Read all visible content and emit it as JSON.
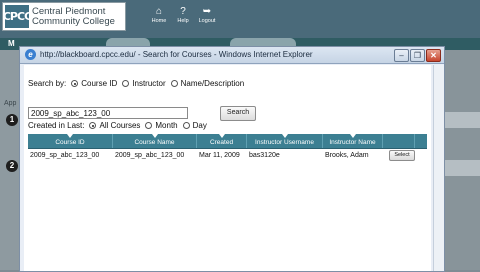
{
  "app": {
    "logo_mark": "CPCC",
    "college_line1": "Central Piedmont",
    "college_line2": "Community College",
    "header_icons": [
      {
        "name": "home-icon",
        "label": "Home",
        "glyph": "⌂"
      },
      {
        "name": "help-icon",
        "label": "Help",
        "glyph": "?"
      },
      {
        "name": "logout-icon",
        "label": "Logout",
        "glyph": "➥"
      }
    ],
    "first_tab": "M",
    "side_text": "App",
    "step_numbers": [
      "1",
      "2"
    ]
  },
  "window": {
    "title": "http://blackboard.cpcc.edu/ - Search for Courses - Windows Internet Explorer",
    "ie_icon": "e",
    "minimize": "–",
    "restore": "❐",
    "close": "✕"
  },
  "search": {
    "search_by_label": "Search by:",
    "options": [
      "Course ID",
      "Instructor",
      "Name/Description"
    ],
    "selected_option": "Course ID",
    "query_value": "2009_sp_abc_123_00",
    "search_button": "Search",
    "created_label": "Created in Last:",
    "created_options": [
      "All Courses",
      "Month",
      "Day"
    ],
    "selected_created": "All Courses"
  },
  "table": {
    "columns": [
      "Course ID",
      "Course Name",
      "Created",
      "Instructor Username",
      "Instructor Name",
      "",
      ""
    ],
    "rows": [
      {
        "course_id": "2009_sp_abc_123_00",
        "course_name": "2009_sp_abc_123_00",
        "created": "Mar 11, 2009",
        "instructor_username": "bas3120e",
        "instructor_name": "Brooks, Adam",
        "action": "Select"
      }
    ]
  },
  "colors": {
    "header_bg": "#4a6a7a",
    "table_header": "#3c7f92",
    "titlebar": "#c6d4e5"
  }
}
